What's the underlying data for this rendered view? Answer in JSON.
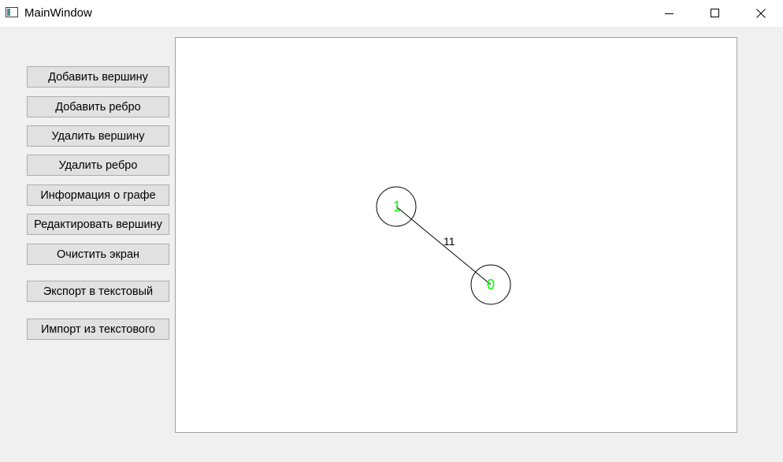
{
  "window": {
    "title": "MainWindow",
    "controls": {
      "minimize_icon": "minimize-icon",
      "maximize_icon": "maximize-icon",
      "close_icon": "close-icon"
    }
  },
  "sidebar": {
    "buttons": [
      {
        "label": "Добавить вершину"
      },
      {
        "label": "Добавить ребро"
      },
      {
        "label": "Удалить вершину"
      },
      {
        "label": "Удалить ребро"
      },
      {
        "label": "Информация о графе"
      },
      {
        "label": "Редактировать вершину"
      },
      {
        "label": "Очистить экран"
      },
      {
        "label": "Экспорт в текстовый"
      },
      {
        "label": "Импорт из текстового"
      }
    ]
  },
  "graph": {
    "vertices": [
      {
        "label": "1"
      },
      {
        "label": "0"
      }
    ],
    "edges": [
      {
        "from": "1",
        "to": "0",
        "weight": "11"
      }
    ],
    "colors": {
      "vertex_label": "#00ff00",
      "vertex_outline": "#000000",
      "edge": "#000000"
    }
  }
}
